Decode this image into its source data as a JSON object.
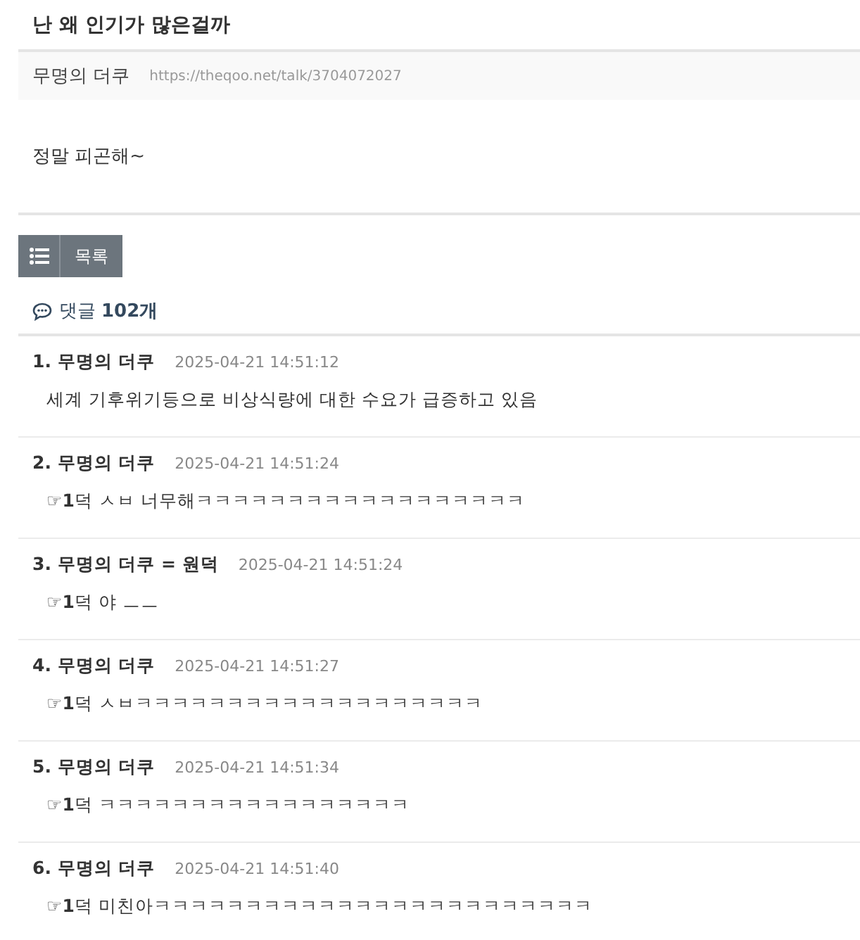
{
  "title": "난 왜 인기가 많은걸까",
  "meta": {
    "author": "무명의 더쿠",
    "url": "https://theqoo.net/talk/3704072027"
  },
  "body": "정말 피곤해~",
  "list_button": {
    "label": "목록"
  },
  "comments_header": {
    "label": "댓글",
    "count": "102개"
  },
  "comments": [
    {
      "author": "1. 무명의 더쿠",
      "time": "2025-04-21 14:51:12",
      "text": "세계 기후위기등으로 비상식량에 대한 수요가 급증하고 있음"
    },
    {
      "author": "2. 무명의 더쿠",
      "time": "2025-04-21 14:51:24",
      "text": "**☞1**덕 ㅅㅂ 너무해ㅋㅋㅋㅋㅋㅋㅋㅋㅋㅋㅋㅋㅋㅋㅋㅋㅋㅋ"
    },
    {
      "author": "3. 무명의 더쿠 = 원덕",
      "time": "2025-04-21 14:51:24",
      "text": "**☞1**덕 야 ㅡㅡ"
    },
    {
      "author": "4. 무명의 더쿠",
      "time": "2025-04-21 14:51:27",
      "text": "**☞1**덕 ㅅㅂㅋㅋㅋㅋㅋㅋㅋㅋㅋㅋㅋㅋㅋㅋㅋㅋㅋㅋㅋ"
    },
    {
      "author": "5. 무명의 더쿠",
      "time": "2025-04-21 14:51:34",
      "text": "**☞1**덕 ㅋㅋㅋㅋㅋㅋㅋㅋㅋㅋㅋㅋㅋㅋㅋㅋㅋ"
    },
    {
      "author": "6. 무명의 더쿠",
      "time": "2025-04-21 14:51:40",
      "text": "**☞1**덕 미친아ㅋㅋㅋㅋㅋㅋㅋㅋㅋㅋㅋㅋㅋㅋㅋㅋㅋㅋㅋㅋㅋㅋㅋㅋ"
    }
  ]
}
